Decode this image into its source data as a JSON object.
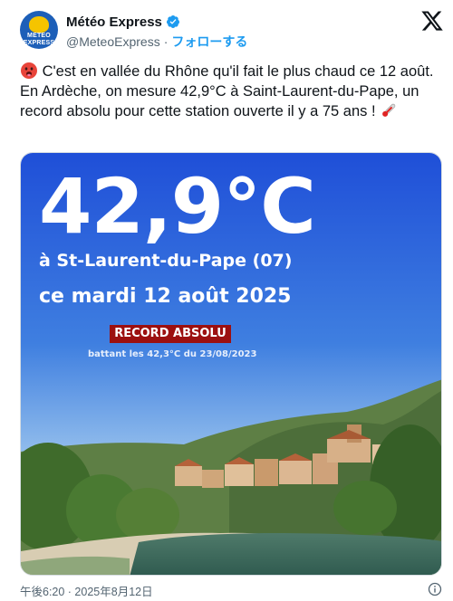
{
  "account": {
    "display_name": "Météo Express",
    "handle": "@MeteoExpress",
    "separator": "·",
    "follow_label": "フォローする",
    "avatar_text": "METEO EXPRESS"
  },
  "tweet": {
    "text": "C'est en vallée du Rhône qu'il fait le plus chaud ce 12 août. En Ardèche, on mesure 42,9°C à Saint-Laurent-du-Pape, un record absolu pour cette station ouverte il y a 75 ans !",
    "emoji_start": "hot-face-emoji",
    "emoji_end": "thermometer-emoji"
  },
  "media": {
    "temperature": "42,9°C",
    "location": "à St-Laurent-du-Pape (07)",
    "date": "ce mardi 12 août 2025",
    "badge": "RECORD ABSOLU",
    "previous_record": "battant les 42,3°C du 23/08/2023",
    "colors": {
      "sky_top": "#1f4fd8",
      "sky_bottom": "#9fc7ee",
      "badge": "#9c1010"
    }
  },
  "footer": {
    "timestamp": "午後6:20 · 2025年8月12日"
  }
}
